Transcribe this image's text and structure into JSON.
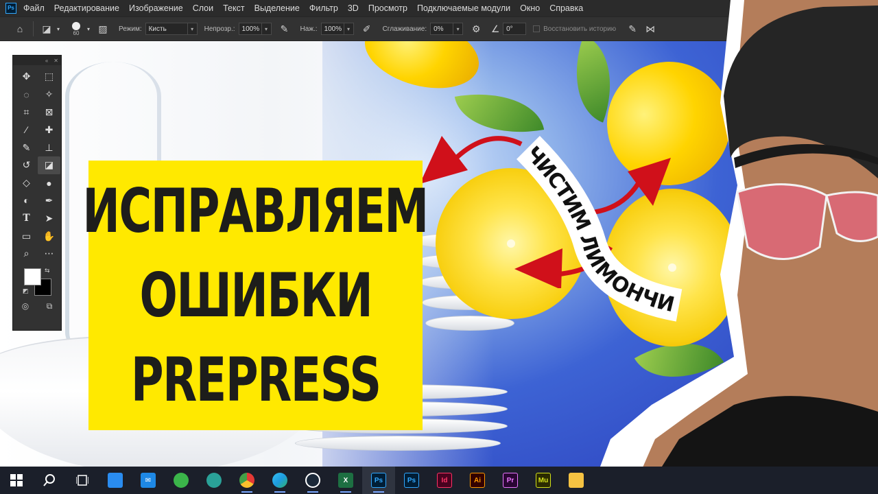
{
  "menubar": {
    "logo": "Ps",
    "items": [
      "Файл",
      "Редактирование",
      "Изображение",
      "Слои",
      "Текст",
      "Выделение",
      "Фильтр",
      "3D",
      "Просмотр",
      "Подключаемые модули",
      "Окно",
      "Справка"
    ]
  },
  "options": {
    "brush_size": "60",
    "mode_label": "Режим:",
    "mode_value": "Кисть",
    "opacity_label": "Непрозр.:",
    "opacity_value": "100%",
    "pressure_label": "Наж.:",
    "pressure_value": "100%",
    "smoothing_label": "Сглаживание:",
    "smoothing_value": "0%",
    "angle_value": "0°",
    "restore_history_label": "Восстановить историю"
  },
  "canvas": {
    "title_lines": [
      "ИСПРАВЛЯЕМ",
      "ОШИБКИ",
      "PREPRESS"
    ],
    "banner_text": "ЧИСТИМ ЛИМОНЧИКИ",
    "cursor": "×"
  },
  "colors": {
    "title_bg": "#ffe900",
    "title_text": "#1d1d1b",
    "arrow": "#d0101a",
    "foreground": "#ffffff",
    "background": "#000000"
  },
  "taskbar": {
    "apps": [
      {
        "name": "windows-start",
        "label": "",
        "color": "#4da3ff"
      },
      {
        "name": "search",
        "label": "",
        "color": "#ffffff"
      },
      {
        "name": "task-view",
        "label": "",
        "color": "#ffffff"
      },
      {
        "name": "store",
        "label": "",
        "color": "#2a8cf0"
      },
      {
        "name": "mail",
        "label": "",
        "color": "#1e88e5"
      },
      {
        "name": "vpn",
        "label": "",
        "color": "#3bb54a"
      },
      {
        "name": "app-teal",
        "label": "",
        "color": "#2aa198"
      },
      {
        "name": "chrome",
        "label": "",
        "color": "#e53935"
      },
      {
        "name": "edge",
        "label": "",
        "color": "#1e9be0"
      },
      {
        "name": "steam",
        "label": "",
        "color": "#1b2838"
      },
      {
        "name": "excel",
        "label": "X",
        "color": "#1d6f42"
      },
      {
        "name": "photoshop-active",
        "label": "Ps",
        "color": "#31a8ff"
      },
      {
        "name": "photoshop",
        "label": "Ps",
        "color": "#31a8ff"
      },
      {
        "name": "indesign",
        "label": "Id",
        "color": "#ff3366"
      },
      {
        "name": "illustrator",
        "label": "Ai",
        "color": "#ff9a00"
      },
      {
        "name": "premiere",
        "label": "Pr",
        "color": "#ea77ff"
      },
      {
        "name": "muse",
        "label": "Mu",
        "color": "#d4e31b"
      },
      {
        "name": "explorer",
        "label": "",
        "color": "#f5c242"
      }
    ]
  }
}
